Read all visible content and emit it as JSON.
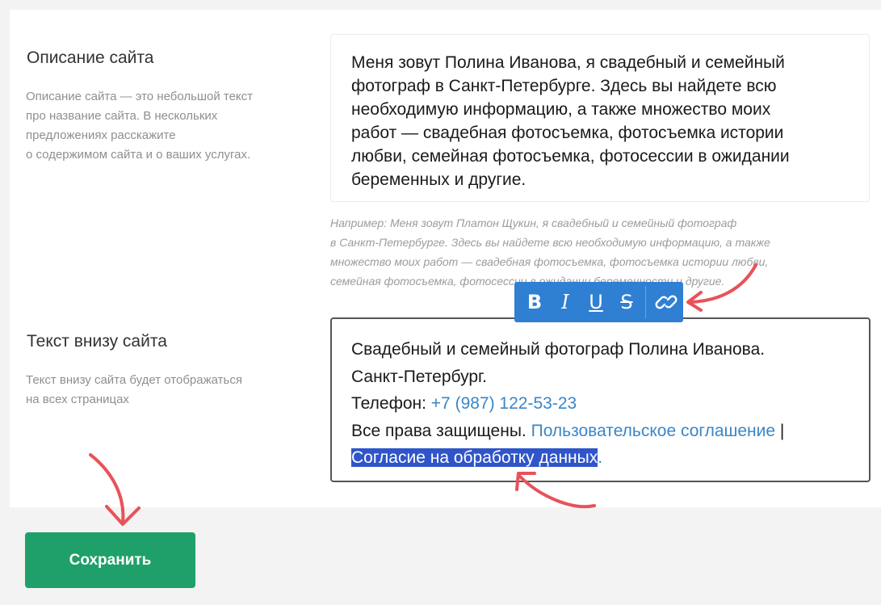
{
  "description_section": {
    "title": "Описание сайта",
    "help_lines": [
      "Описание сайта — это небольшой текст",
      "про название сайта. В нескольких",
      "предложениях расскажите",
      "о содержимом сайта и о ваших услугах."
    ],
    "value_lines": [
      "Меня зовут Полина Иванова, я свадебный и семейный",
      "фотограф в Санкт-Петербурге. Здесь вы найдете всю",
      "необходимую информацию, а также множество моих",
      "работ — свадебная фотосъемка, фотосъемка истории",
      "любви, семейная фотосъемка, фотосессии в ожидании",
      "беременных и другие."
    ],
    "example_lines": [
      "Например: Меня зовут Платон Щукин, я свадебный и семейный фотограф",
      "в Санкт-Петербурге. Здесь вы найдете всю необходимую информацию, а также",
      "множество моих работ — свадебная фотосъемка, фотосъемка истории любви,",
      "семейная фотосъемка, фотосессии в ожидании беременности и другие."
    ]
  },
  "footer_section": {
    "title": "Текст внизу сайта",
    "help_lines": [
      "Текст внизу сайта будет отображаться",
      "на всех страницах"
    ],
    "line1": "Свадебный и семейный фотограф Полина Иванова.",
    "line2": "Санкт-Петербург.",
    "phone_label": "Телефон: ",
    "phone": "+7 (987) 122-53-23",
    "rights": "Все права защищены. ",
    "agreement_link": "Пользовательское соглашение",
    "separator": " |",
    "consent_link": "Согласие на обработку данных",
    "consent_dot": "."
  },
  "toolbar": {
    "bold": "B",
    "italic": "I",
    "underline": "U",
    "strike": "S",
    "link_icon": "link-icon"
  },
  "actions": {
    "save": "Сохранить"
  },
  "colors": {
    "toolbar": "#2f7fd3",
    "link": "#3a86c8",
    "selection": "#2f55c9",
    "save_button": "#1fa06a",
    "arrow": "#e8525a"
  }
}
